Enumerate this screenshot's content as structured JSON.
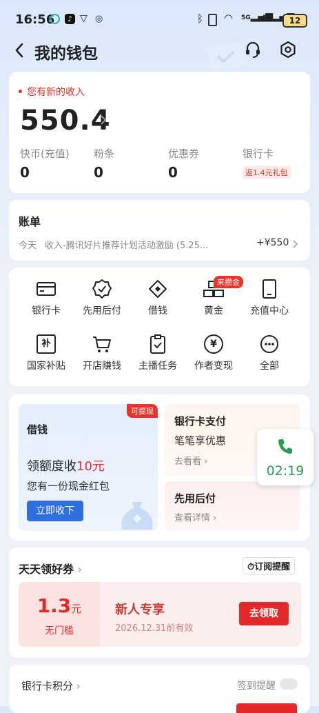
{
  "status": {
    "time": "16:56",
    "battery": "12"
  },
  "header": {
    "title": "我的钱包"
  },
  "balance": {
    "notice": "您有新的收入",
    "amount": "550.4",
    "items": [
      {
        "label": "快币(充值)",
        "value": "0"
      },
      {
        "label": "粉条",
        "value": "0"
      },
      {
        "label": "优惠券",
        "value": "0"
      },
      {
        "label": "银行卡",
        "tag": "返1.4元礼包"
      }
    ]
  },
  "bill": {
    "title": "账单",
    "date": "今天",
    "desc": "收入-腾讯好片推荐计划活动激励 (5.25...",
    "amount": "+¥550"
  },
  "grid": {
    "items": [
      {
        "label": "银行卡"
      },
      {
        "label": "先用后付"
      },
      {
        "label": "借钱"
      },
      {
        "label": "黄金",
        "badge": "来攒金"
      },
      {
        "label": "充值中心"
      },
      {
        "label": "国家补贴",
        "glyph": "补"
      },
      {
        "label": "开店赚钱"
      },
      {
        "label": "主播任务"
      },
      {
        "label": "作者变现",
        "glyph": "¥"
      },
      {
        "label": "全部"
      }
    ]
  },
  "promo": {
    "loan": {
      "title": "借钱",
      "badge": "可提现",
      "headline_pre": "领额度收",
      "headline_hl": "10元",
      "sub": "您有一份现金红包",
      "button": "立即收下"
    },
    "bankpay": {
      "title": "银行卡支付",
      "sub": "笔笔享优惠",
      "link": "去看看"
    },
    "bnpl": {
      "title": "先用后付",
      "link": "查看详情"
    }
  },
  "call": {
    "timer": "02:19"
  },
  "coupons": {
    "title": "天天领好券",
    "subscribe": "订阅提醒",
    "amount": "1.3",
    "unit": "元",
    "threshold": "无门槛",
    "name": "新人专享",
    "expiry": "2026.12.31前有效",
    "button": "去领取"
  },
  "points": {
    "title": "银行卡积分",
    "reminder": "签到提醒"
  }
}
